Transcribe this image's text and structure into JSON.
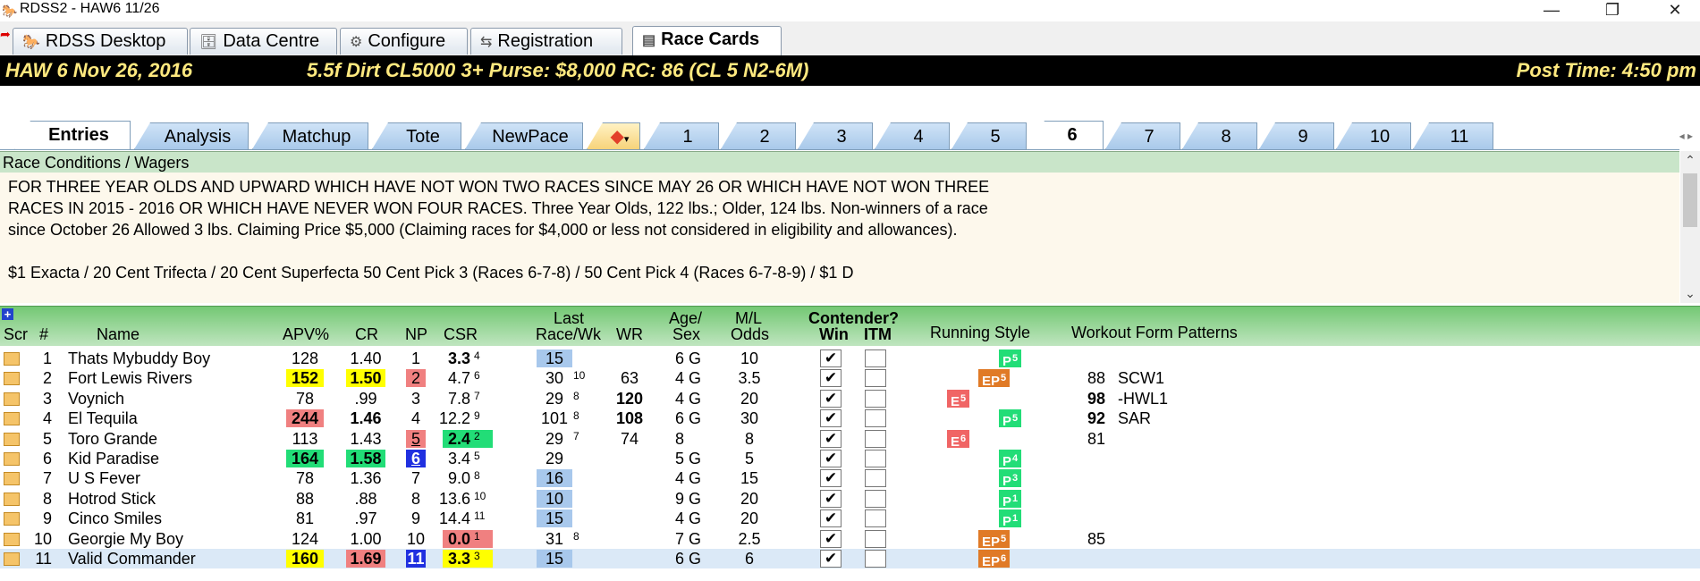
{
  "window": {
    "title": "RDSS2 - HAW6  11/26",
    "minimize": "—",
    "restore": "❐",
    "close": "✕"
  },
  "main_tabs": [
    {
      "label": "RDSS Desktop",
      "icon": "desktop-icon",
      "glyph": "🐎"
    },
    {
      "label": "Data Centre",
      "icon": "database-icon",
      "glyph": "🗄"
    },
    {
      "label": "Configure",
      "icon": "gear-icon",
      "glyph": "⚙"
    },
    {
      "label": "Registration",
      "icon": "registration-icon",
      "glyph": "⇆"
    },
    {
      "label": "Race Cards",
      "icon": "card-icon",
      "glyph": "▤"
    }
  ],
  "race_header": {
    "track": "HAW  6   Nov 26, 2016",
    "details": "5.5f  Dirt   CL5000  3+   Purse: $8,000   RC: 86  (CL 5 N2-6M)",
    "post_time": "Post Time: 4:50 pm"
  },
  "sub_tabs": [
    "Entries",
    "Analysis",
    "Matchup",
    "Tote",
    "NewPace",
    "",
    "1",
    "2",
    "3",
    "4",
    "5",
    "6",
    "7",
    "8",
    "9",
    "10",
    "11"
  ],
  "conditions": {
    "header": "Race Conditions / Wagers",
    "lines": [
      "FOR THREE YEAR OLDS AND UPWARD WHICH HAVE NOT WON TWO RACES SINCE MAY 26 OR WHICH HAVE NOT WON THREE",
      "RACES IN 2015 - 2016 OR WHICH HAVE NEVER WON FOUR RACES. Three Year Olds, 122 lbs.; Older, 124 lbs. Non-winners of a race",
      "since October 26 Allowed 3 lbs. Claiming Price $5,000 (Claiming races for $4,000 or less not considered in eligibility and allowances).",
      "",
      "$1 Exacta / 20 Cent Trifecta / 20 Cent Superfecta 50 Cent Pick 3 (Races 6-7-8) / 50 Cent Pick 4 (Races 6-7-8-9) / $1 D"
    ]
  },
  "grid_header": {
    "plus": "+",
    "scr": "Scr",
    "num": "#",
    "name": "Name",
    "apv": "APV%",
    "cr": "CR",
    "np": "NP",
    "csr": "CSR",
    "last1": "Last",
    "last2": "Race/Wk",
    "wr": "WR",
    "age1": "Age/",
    "age2": "Sex",
    "ml1": "M/L",
    "ml2": "Odds",
    "contender": "Contender?",
    "win": "Win",
    "itm": "ITM",
    "running_style": "Running Style",
    "workout": "Workout Form Patterns"
  },
  "colors": {
    "yellow": "#ffff00",
    "red": "#f08080",
    "green": "#22dd77",
    "blue": "#2030e0",
    "lightblue": "#a8c8ec",
    "orange": "#e07a26",
    "rs_green": "#22dd77",
    "rs_red": "#f06565"
  },
  "entries": [
    {
      "num": "1",
      "name": "Thats Mybuddy Boy",
      "apv": "128",
      "cr": "1.40",
      "np": "1",
      "csr": "3.3",
      "csr_rank": "4",
      "last": "15",
      "last_sup": "",
      "wr": "",
      "age": "6 G",
      "ml": "10",
      "win": "✔",
      "rs": "P",
      "rs_n": "5",
      "wo_num": "",
      "wo_pat": ""
    },
    {
      "num": "2",
      "name": "Fort Lewis Rivers",
      "apv": "152",
      "cr": "1.50",
      "np": "2",
      "csr": "4.7",
      "csr_rank": "6",
      "last": "30",
      "last_sup": "10",
      "wr": "63",
      "age": "4 G",
      "ml": "3.5",
      "win": "✔",
      "rs": "EP",
      "rs_n": "5",
      "wo_num": "88",
      "wo_pat": "SCW1"
    },
    {
      "num": "3",
      "name": "Voynich",
      "apv": "78",
      "cr": ".99",
      "np": "3",
      "csr": "7.8",
      "csr_rank": "7",
      "last": "29",
      "last_sup": "8",
      "wr": "120",
      "age": "4 G",
      "ml": "20",
      "win": "✔",
      "rs": "E",
      "rs_n": "5",
      "wo_num": "98",
      "wo_pat": "-HWL1"
    },
    {
      "num": "4",
      "name": "El Tequila",
      "apv": "244",
      "cr": "1.46",
      "np": "4",
      "csr": "12.2",
      "csr_rank": "9",
      "last": "101",
      "last_sup": "8",
      "wr": "108",
      "age": "6 G",
      "ml": "30",
      "win": "✔",
      "rs": "P",
      "rs_n": "5",
      "wo_num": "92",
      "wo_pat": "SAR"
    },
    {
      "num": "5",
      "name": "Toro Grande",
      "apv": "113",
      "cr": "1.43",
      "np": "5",
      "csr": "2.4",
      "csr_rank": "2",
      "last": "29",
      "last_sup": "7",
      "wr": "74",
      "age": "8",
      "ml": "8",
      "win": "✔",
      "rs": "E",
      "rs_n": "6",
      "wo_num": "81",
      "wo_pat": ""
    },
    {
      "num": "6",
      "name": "Kid Paradise",
      "apv": "164",
      "cr": "1.58",
      "np": "6",
      "csr": "3.4",
      "csr_rank": "5",
      "last": "29",
      "last_sup": "",
      "wr": "",
      "age": "5 G",
      "ml": "5",
      "win": "✔",
      "rs": "P",
      "rs_n": "4",
      "wo_num": "",
      "wo_pat": ""
    },
    {
      "num": "7",
      "name": "U S Fever",
      "apv": "78",
      "cr": "1.36",
      "np": "7",
      "csr": "9.0",
      "csr_rank": "8",
      "last": "16",
      "last_sup": "",
      "wr": "",
      "age": "4 G",
      "ml": "15",
      "win": "✔",
      "rs": "P",
      "rs_n": "3",
      "wo_num": "",
      "wo_pat": ""
    },
    {
      "num": "8",
      "name": "Hotrod Stick",
      "apv": "88",
      "cr": ".88",
      "np": "8",
      "csr": "13.6",
      "csr_rank": "10",
      "last": "10",
      "last_sup": "",
      "wr": "",
      "age": "9 G",
      "ml": "20",
      "win": "✔",
      "rs": "P",
      "rs_n": "1",
      "wo_num": "",
      "wo_pat": ""
    },
    {
      "num": "9",
      "name": "Cinco Smiles",
      "apv": "81",
      "cr": ".97",
      "np": "9",
      "csr": "14.4",
      "csr_rank": "11",
      "last": "15",
      "last_sup": "",
      "wr": "",
      "age": "4 G",
      "ml": "20",
      "win": "✔",
      "rs": "P",
      "rs_n": "1",
      "wo_num": "",
      "wo_pat": ""
    },
    {
      "num": "10",
      "name": "Georgie My Boy",
      "apv": "124",
      "cr": "1.00",
      "np": "10",
      "csr": "0.0",
      "csr_rank": "1",
      "last": "31",
      "last_sup": "8",
      "wr": "",
      "age": "7 G",
      "ml": "2.5",
      "win": "✔",
      "rs": "EP",
      "rs_n": "5",
      "wo_num": "85",
      "wo_pat": ""
    },
    {
      "num": "11",
      "name": "Valid Commander",
      "apv": "160",
      "cr": "1.69",
      "np": "11",
      "csr": "3.3",
      "csr_rank": "3",
      "last": "15",
      "last_sup": "",
      "wr": "",
      "age": "6 G",
      "ml": "6",
      "win": "✔",
      "rs": "EP",
      "rs_n": "6",
      "wo_num": "",
      "wo_pat": ""
    }
  ]
}
